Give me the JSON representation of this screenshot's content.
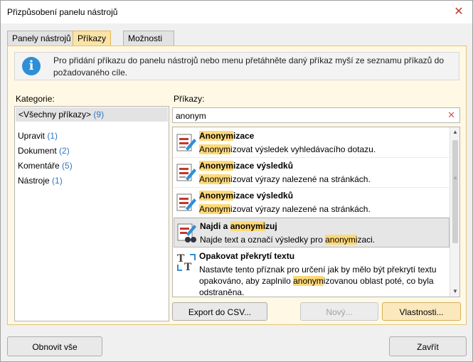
{
  "window": {
    "title": "Přizpůsobení panelu nástrojů"
  },
  "tabs": [
    {
      "label": "Panely nástrojů"
    },
    {
      "label": "Příkazy"
    },
    {
      "label": "Možnosti"
    }
  ],
  "info": {
    "text": "Pro přidání příkazu do panelu nástrojů nebo menu přetáhněte daný příkaz myší ze seznamu příkazů do požadovaného cíle."
  },
  "categories": {
    "label": "Kategorie:",
    "all": {
      "name": "<Všechny příkazy>",
      "count": "(9)"
    },
    "items": [
      {
        "name": "Upravit",
        "count": "(1)"
      },
      {
        "name": "Dokument",
        "count": "(2)"
      },
      {
        "name": "Komentáře",
        "count": "(5)"
      },
      {
        "name": "Nástroje",
        "count": "(1)"
      }
    ]
  },
  "commands": {
    "label": "Příkazy:",
    "search": {
      "value": "anonym"
    },
    "items": [
      {
        "title_hl": "Anonym",
        "title_rest": "izace",
        "desc_pre": "",
        "desc_hl": "Anonym",
        "desc_post": "izovat výsledek vyhledávacího dotazu.",
        "icon": "redact-pencil-icon"
      },
      {
        "title_hl": "Anonym",
        "title_rest": "izace výsledků",
        "desc_pre": "",
        "desc_hl": "Anonym",
        "desc_post": "izovat výrazy nalezené na stránkách.",
        "icon": "redact-pencil-icon"
      },
      {
        "title_hl": "Anonym",
        "title_rest": "izace výsledků",
        "desc_pre": "",
        "desc_hl": "Anonym",
        "desc_post": "izovat výrazy nalezené na stránkách.",
        "icon": "redact-pencil-icon"
      },
      {
        "title_pre": "Najdi a ",
        "title_hl": "anonymi",
        "title_rest": "zuj",
        "desc_pre": "Najde text a označí výsledky pro ",
        "desc_hl": "anonymi",
        "desc_post": "zaci.",
        "icon": "find-redact-icon"
      },
      {
        "title": "Opakovat překrytí textu",
        "desc_pre": "Nastavte tento příznak pro určení jak by mělo být překrytí textu opakováno, aby zaplnilo ",
        "desc_hl": "anonym",
        "desc_post": "izovanou oblast poté, co byla odstraněna.",
        "icon": "repeat-text-overlay-icon"
      }
    ]
  },
  "buttons": {
    "export": "Export do CSV...",
    "new": "Nový...",
    "properties": "Vlastnosti...",
    "reset": "Obnovit vše",
    "close": "Zavřít"
  },
  "colors": {
    "accent": "#fbe3a6",
    "highlight": "#ffd978",
    "count": "#2e75c5",
    "info": "#2d8fd6"
  }
}
